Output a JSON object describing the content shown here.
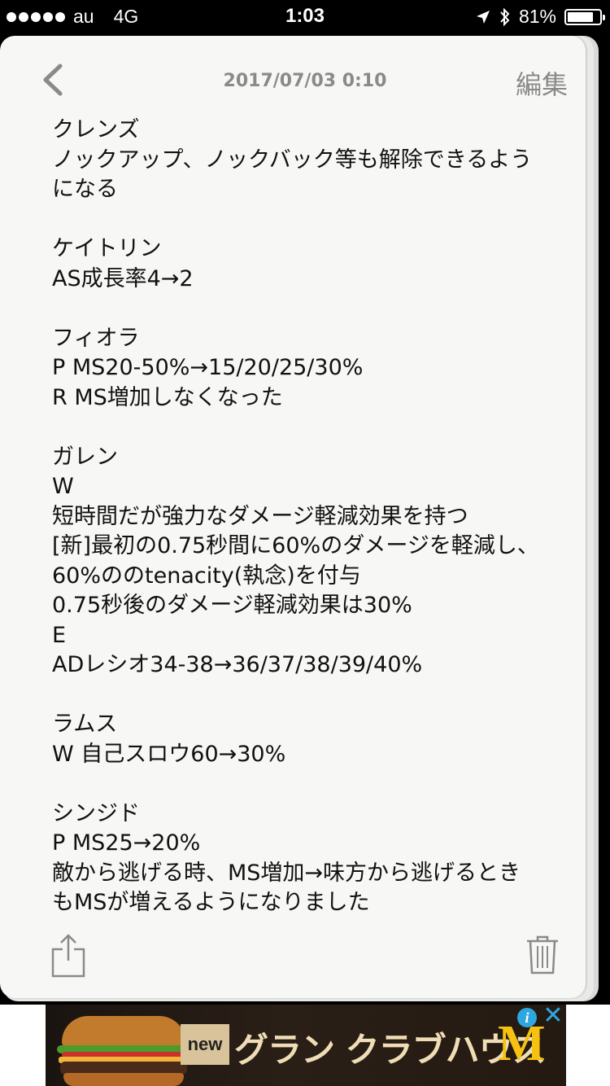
{
  "status_bar": {
    "carrier": "au",
    "network": "4G",
    "time": "1:03",
    "battery": "81%",
    "battery_level": 0.81
  },
  "nav": {
    "date": "2017/07/03 0:10",
    "edit_label": "編集"
  },
  "note_lines": [
    "クレンズ",
    "ノックアップ、ノックバック等も解除できるよう",
    "になる",
    "",
    "ケイトリン",
    "AS成長率4→2",
    "",
    "フィオラ",
    "P MS20-50%→15/20/25/30%",
    "R MS増加しなくなった",
    "",
    "ガレン",
    "W",
    "短時間だが強力なダメージ軽減効果を持つ",
    "[新]最初の0.75秒間に60%のダメージを軽減し、",
    "60%ののtenacity(執念)を付与",
    "0.75秒後のダメージ軽減効果は30%",
    "E",
    "ADレシオ34-38→36/37/38/39/40%",
    "",
    "ラムス",
    "W 自己スロウ60→30%",
    "",
    "シンジド",
    "P MS25→20%",
    "敵から逃げる時、MS増加→味方から逃げるとき",
    "もMSが増えるようになりました"
  ],
  "ad": {
    "badge": "new",
    "title": "グラン クラブハウス",
    "logo": "M",
    "info_icon": "i",
    "close_icon": "✕"
  }
}
